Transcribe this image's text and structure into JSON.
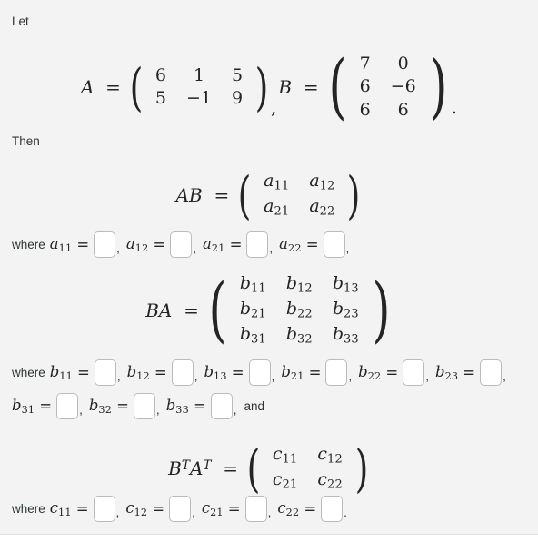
{
  "intro": {
    "let_label": "Let",
    "then_label": "Then"
  },
  "matrices": {
    "A": {
      "name": "A",
      "equals": "=",
      "rows": [
        [
          "6",
          "1",
          "5"
        ],
        [
          "5",
          "−1",
          "9"
        ]
      ]
    },
    "B": {
      "name": "B",
      "equals": "=",
      "rows": [
        [
          "7",
          "0"
        ],
        [
          "6",
          "−6"
        ],
        [
          "6",
          "6"
        ]
      ]
    },
    "separator": ",",
    "period": "."
  },
  "products": {
    "AB": {
      "label_main": "AB",
      "equals": "=",
      "rows": [
        [
          "a",
          "a"
        ],
        [
          "a",
          "a"
        ]
      ],
      "cells": [
        [
          "a11",
          "a12"
        ],
        [
          "a21",
          "a22"
        ]
      ],
      "subs": [
        [
          "11",
          "12"
        ],
        [
          "21",
          "22"
        ]
      ],
      "var": "a"
    },
    "BA": {
      "label_main": "BA",
      "equals": "=",
      "subs": [
        [
          "11",
          "12",
          "13"
        ],
        [
          "21",
          "22",
          "23"
        ],
        [
          "31",
          "32",
          "33"
        ]
      ],
      "var": "b"
    },
    "BTAT": {
      "label_b": "B",
      "label_a": "A",
      "transpose": "T",
      "equals": "=",
      "subs": [
        [
          "11",
          "12"
        ],
        [
          "21",
          "22"
        ]
      ],
      "var": "c"
    }
  },
  "answers": {
    "where_label": "where",
    "and_label": "and",
    "comma": ",",
    "period": ".",
    "equals": "=",
    "a_entries": [
      {
        "var": "a",
        "sub": "11",
        "value": ""
      },
      {
        "var": "a",
        "sub": "12",
        "value": ""
      },
      {
        "var": "a",
        "sub": "21",
        "value": ""
      },
      {
        "var": "a",
        "sub": "22",
        "value": ""
      }
    ],
    "b_entries": [
      {
        "var": "b",
        "sub": "11",
        "value": ""
      },
      {
        "var": "b",
        "sub": "12",
        "value": ""
      },
      {
        "var": "b",
        "sub": "13",
        "value": ""
      },
      {
        "var": "b",
        "sub": "21",
        "value": ""
      },
      {
        "var": "b",
        "sub": "22",
        "value": ""
      },
      {
        "var": "b",
        "sub": "23",
        "value": ""
      },
      {
        "var": "b",
        "sub": "31",
        "value": ""
      },
      {
        "var": "b",
        "sub": "32",
        "value": ""
      },
      {
        "var": "b",
        "sub": "33",
        "value": ""
      }
    ],
    "c_entries": [
      {
        "var": "c",
        "sub": "11",
        "value": ""
      },
      {
        "var": "c",
        "sub": "12",
        "value": ""
      },
      {
        "var": "c",
        "sub": "21",
        "value": ""
      },
      {
        "var": "c",
        "sub": "22",
        "value": ""
      }
    ]
  },
  "colors": {
    "panel_background": "#f3f3f3",
    "page_background": "#ffffff",
    "text": "#2f3436",
    "math_text": "#222426",
    "input_border": "#b9bcbe",
    "divider": "#e2e2e2"
  }
}
